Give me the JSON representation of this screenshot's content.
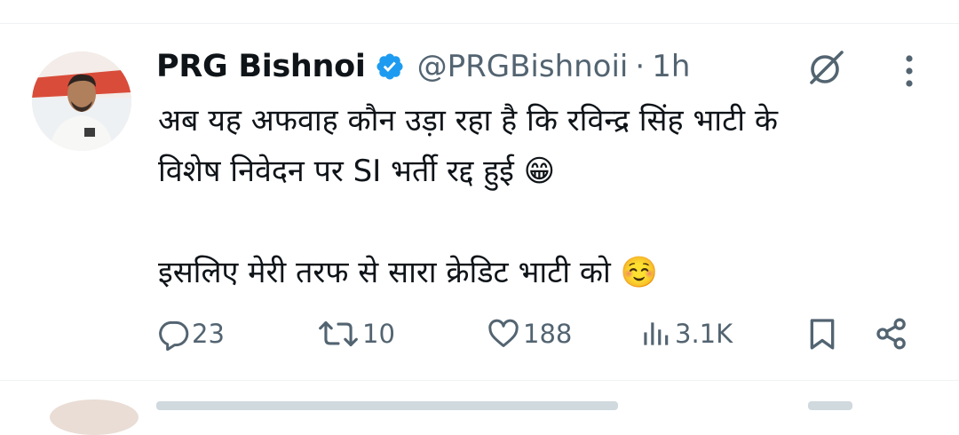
{
  "tweet": {
    "author_name": "PRG Bishnoi",
    "handle": "@PRGBishnoii",
    "separator": "·",
    "time": "1h",
    "text": "अब यह अफवाह कौन उड़ा रहा है कि रविन्द्र सिंह भाटी के\nविशेष निवेदन पर SI भर्ती रद्द हुई 😁\n\nइसलिए मेरी तरफ से सारा क्रेडिट भाटी को ☺️"
  },
  "actions": {
    "replies": "23",
    "reposts": "10",
    "likes": "188",
    "views": "3.1K"
  },
  "icons": {
    "verified": "verified-badge-icon",
    "grok": "grok-icon",
    "more": "more-icon",
    "reply": "reply-icon",
    "repost": "repost-icon",
    "like": "heart-icon",
    "views": "views-icon",
    "bookmark": "bookmark-icon",
    "share": "share-icon"
  },
  "colors": {
    "verified": "#1d9bf0",
    "secondary_text": "#536471",
    "primary_text": "#0f1419"
  }
}
